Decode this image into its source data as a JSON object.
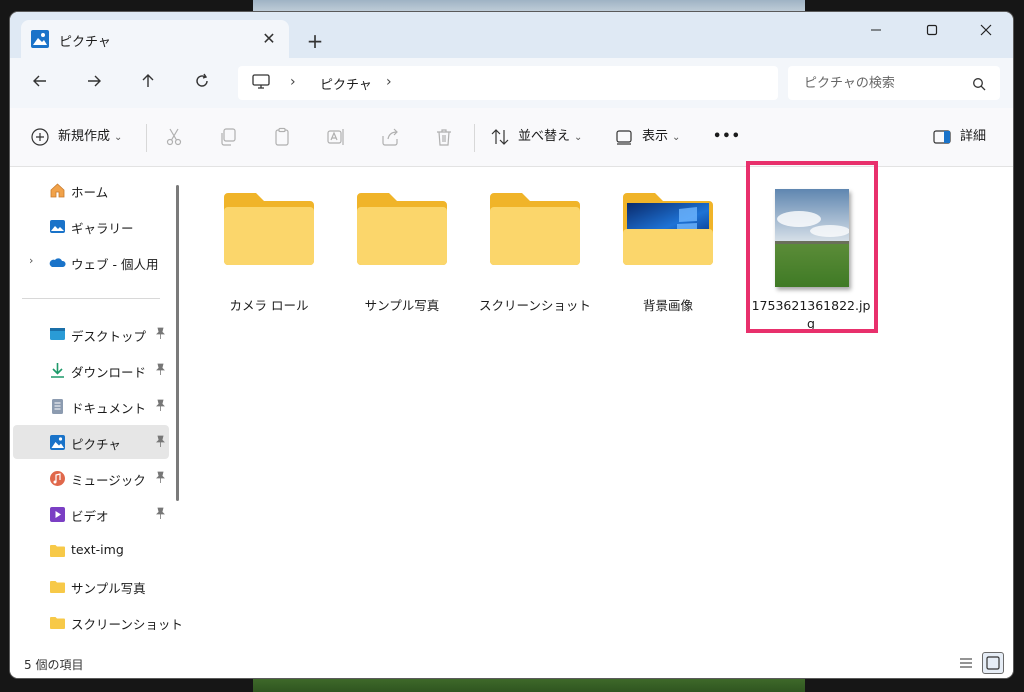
{
  "window": {
    "tab_title": "ピクチャ"
  },
  "addressbar": {
    "breadcrumb": [
      "ピクチャ"
    ],
    "search_placeholder": "ピクチャの検索"
  },
  "toolbar": {
    "new_label": "新規作成",
    "sort_label": "並べ替え",
    "view_label": "表示",
    "more_label": "•••",
    "details_label": "詳細"
  },
  "sidebar": {
    "items": [
      {
        "label": "ホーム",
        "icon": "home-icon"
      },
      {
        "label": "ギャラリー",
        "icon": "gallery-icon"
      },
      {
        "label": "ウェブ - 個人用",
        "icon": "onedrive-icon"
      },
      {
        "label": "デスクトップ",
        "icon": "desktop-icon",
        "pinned": true
      },
      {
        "label": "ダウンロード",
        "icon": "download-icon",
        "pinned": true
      },
      {
        "label": "ドキュメント",
        "icon": "document-icon",
        "pinned": true
      },
      {
        "label": "ピクチャ",
        "icon": "pictures-icon",
        "pinned": true,
        "selected": true
      },
      {
        "label": "ミュージック",
        "icon": "music-icon",
        "pinned": true
      },
      {
        "label": "ビデオ",
        "icon": "video-icon",
        "pinned": true
      },
      {
        "label": "text-img",
        "icon": "folder-icon"
      },
      {
        "label": "サンプル写真",
        "icon": "folder-icon"
      },
      {
        "label": "スクリーンショット",
        "icon": "folder-icon"
      }
    ]
  },
  "content": {
    "items": [
      {
        "label": "カメラ ロール",
        "type": "folder"
      },
      {
        "label": "サンプル写真",
        "type": "folder"
      },
      {
        "label": "スクリーンショット",
        "type": "folder"
      },
      {
        "label": "背景画像",
        "type": "folder-wallpaper"
      },
      {
        "label": "1753621361822.jpg",
        "type": "image"
      }
    ]
  },
  "statusbar": {
    "item_count": "5 個の項目"
  },
  "colors": {
    "titlebar": "#dfe9f4",
    "folder_yellow": "#f8c94a",
    "highlight": "#e8306c",
    "selection": "#e6e6e6"
  }
}
